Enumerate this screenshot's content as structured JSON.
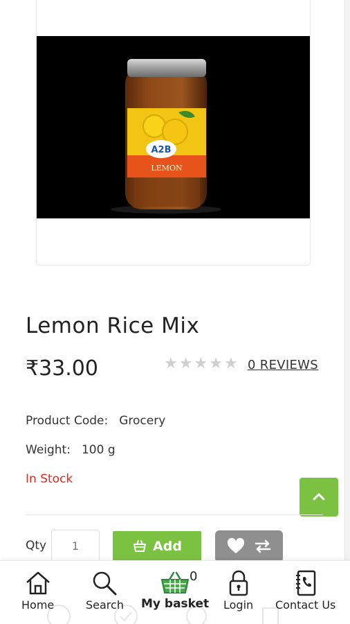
{
  "product": {
    "title": "Lemon Rice Mix",
    "price": "₹33.00",
    "rating_stars": 0,
    "reviews_label": "0 REVIEWS",
    "image": {
      "brand_logo_text": "A2B",
      "label_text": "LEMON"
    }
  },
  "specs": [
    {
      "label": "Product Code:",
      "value": "Grocery"
    },
    {
      "label": "Weight:",
      "value": "100 g"
    }
  ],
  "stock_status": "In Stock",
  "purchase": {
    "qty_label": "Qty",
    "qty_value": "1",
    "add_label": "Add"
  },
  "bottom_nav": {
    "items": [
      {
        "label": "Home",
        "icon": "home-icon"
      },
      {
        "label": "Search",
        "icon": "search-icon"
      },
      {
        "label": "My basket",
        "icon": "basket-icon"
      },
      {
        "label": "Login",
        "icon": "lock-icon"
      },
      {
        "label": "Contact Us",
        "icon": "phone-book-icon"
      }
    ],
    "basket_count": "0"
  },
  "colors": {
    "accent_green": "#7cc242",
    "stock_red": "#e0261b",
    "action_gray": "#8f8f8f"
  }
}
